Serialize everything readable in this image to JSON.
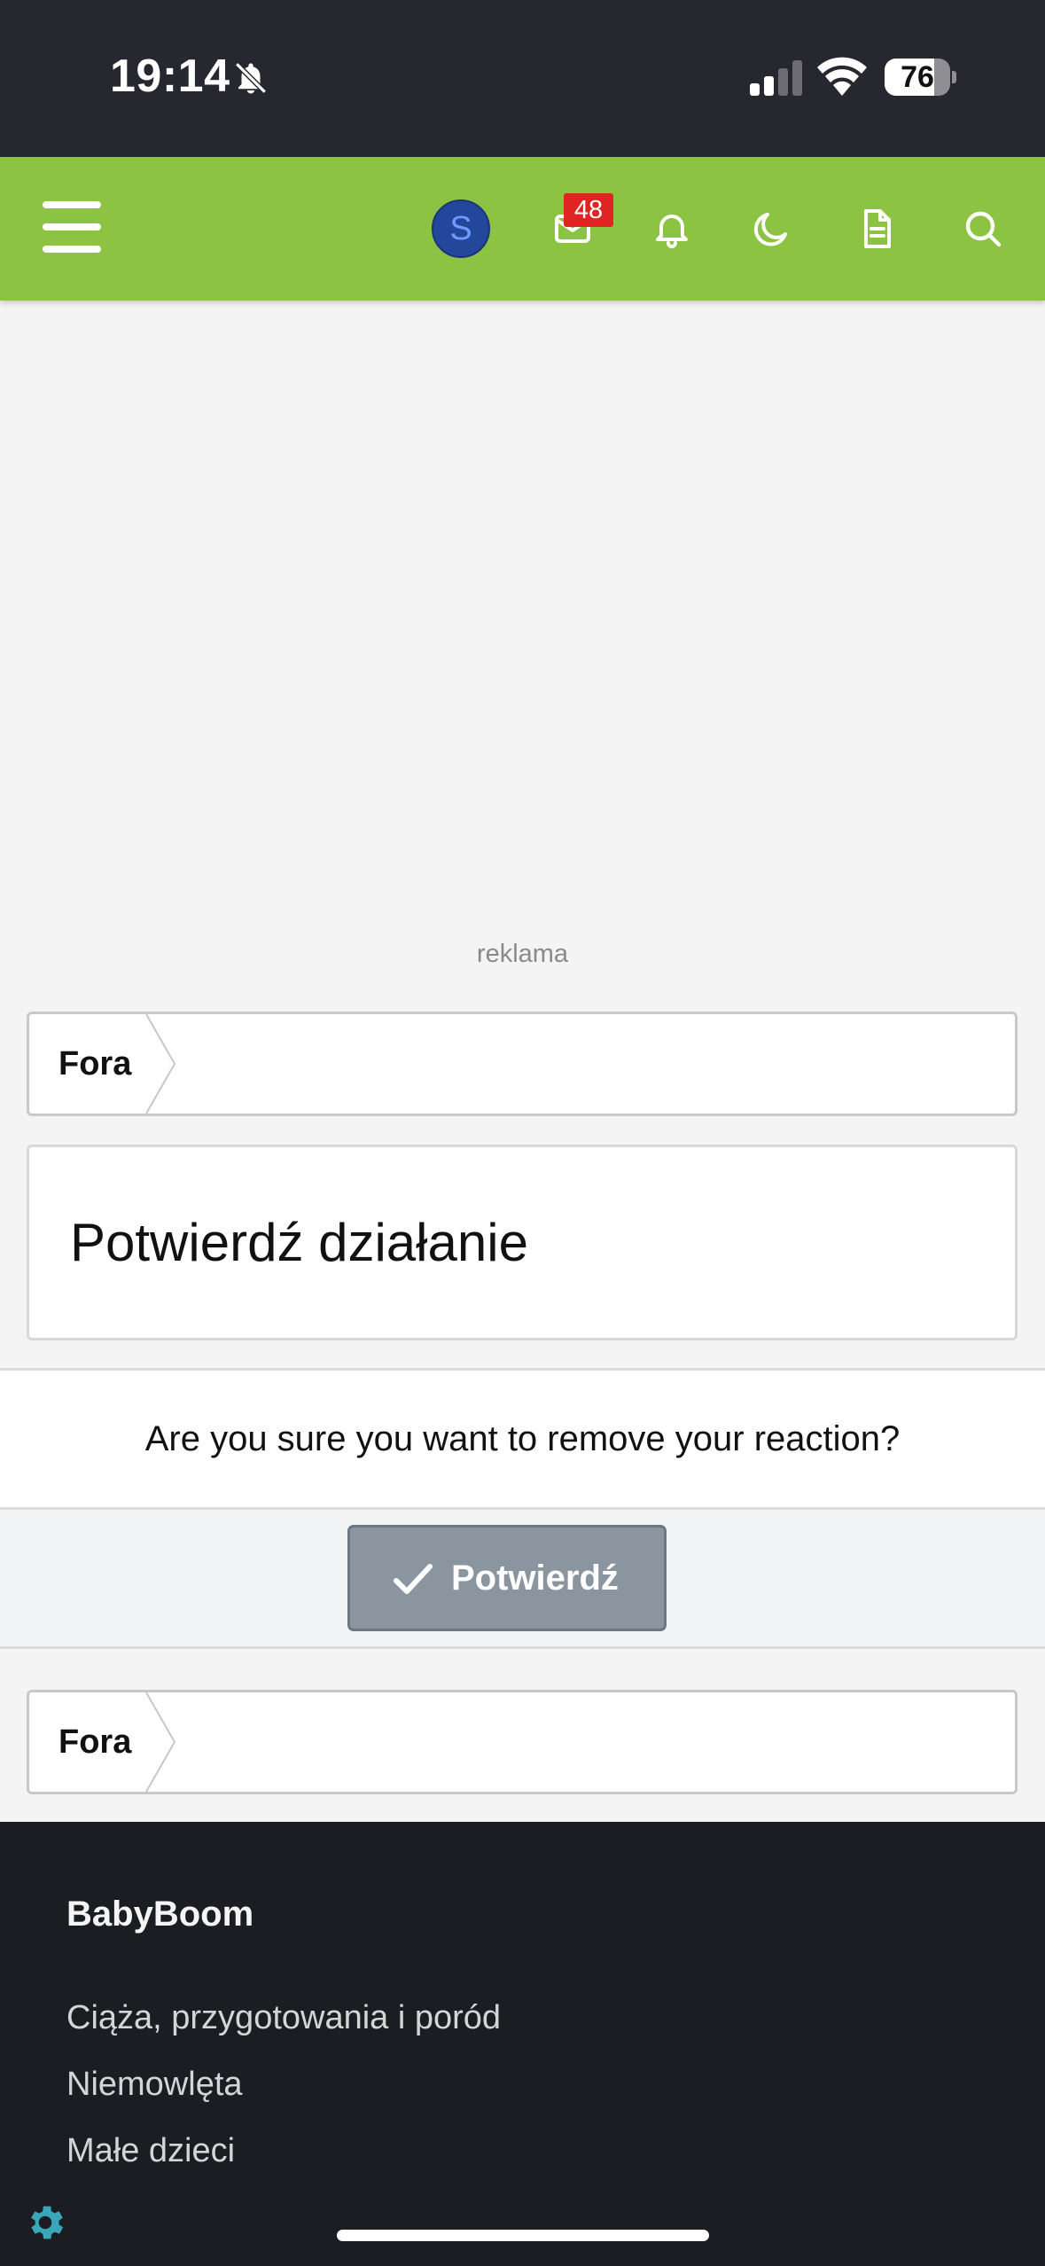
{
  "status_bar": {
    "time": "19:14",
    "battery_level": "76",
    "battery_fraction": 0.76
  },
  "header": {
    "avatar_letter": "S",
    "messages_badge": "48",
    "icons": [
      "menu-icon",
      "avatar",
      "mail-icon",
      "bell-icon",
      "moon-icon",
      "document-icon",
      "search-icon"
    ],
    "accent_color": "#8cc342"
  },
  "ad": {
    "label": "reklama"
  },
  "breadcrumb_top": {
    "item": "Fora"
  },
  "page": {
    "title": "Potwierdź działanie"
  },
  "confirm": {
    "question": "Are you sure you want to remove your reaction?",
    "button_label": "Potwierdź"
  },
  "breadcrumb_bottom": {
    "item": "Fora"
  },
  "footer": {
    "title": "BabyBoom",
    "links": [
      "Ciąża, przygotowania i poród",
      "Niemowlęta",
      "Małe dzieci"
    ]
  }
}
